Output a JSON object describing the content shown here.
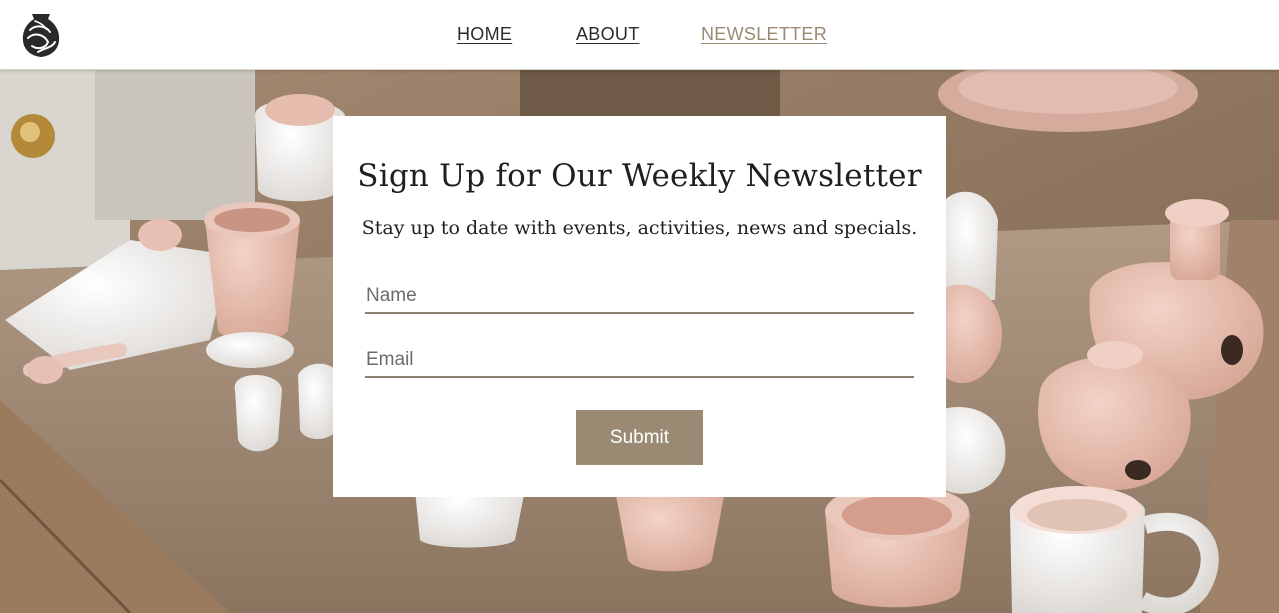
{
  "nav": {
    "items": [
      {
        "label": "HOME"
      },
      {
        "label": "ABOUT"
      },
      {
        "label": "NEWSLETTER",
        "active": true
      }
    ]
  },
  "newsletter": {
    "title": "Sign Up for Our Weekly Newsletter",
    "subtitle": "Stay up to date with events, activities, news and specials.",
    "name_placeholder": "Name",
    "email_placeholder": "Email",
    "submit_label": "Submit"
  },
  "colors": {
    "accent": "#9a8a73",
    "text": "#1f1f1f",
    "background": "#ffffff"
  },
  "icons": {
    "logo": "pottery-vase-logo-icon"
  }
}
